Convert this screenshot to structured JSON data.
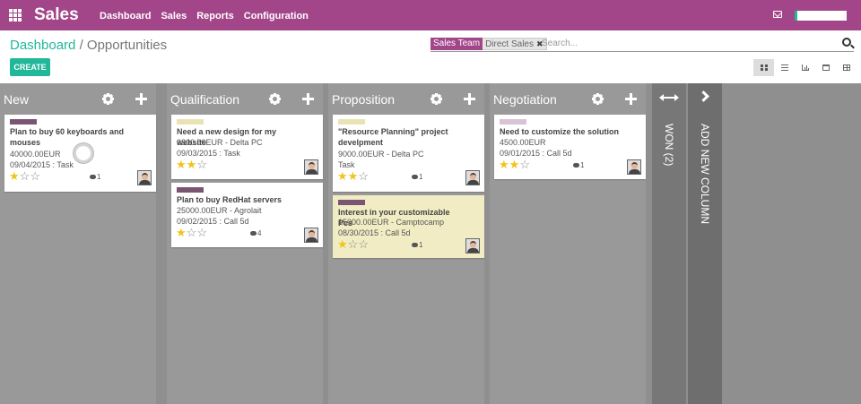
{
  "app": {
    "brand": "Sales",
    "menu": [
      "Dashboard",
      "Sales",
      "Reports",
      "Configuration"
    ]
  },
  "breadcrumb": {
    "parent": "Dashboard",
    "separator": "/",
    "current": "Opportunities"
  },
  "search": {
    "facet_label": "Sales Team",
    "facet_value": "Direct Sales",
    "facet_remove": "✖",
    "placeholder": "Search..."
  },
  "toolbar": {
    "create_label": "CREATE"
  },
  "views": [
    "kanban-view-icon",
    "list-view-icon",
    "graph-view-icon",
    "calendar-view-icon",
    "pivot-view-icon"
  ],
  "colors": {
    "brand": "#a24689",
    "accent": "#21b799",
    "star": "#f0c419"
  },
  "columns": [
    {
      "title": "New",
      "cards": [
        {
          "title": "Plan to buy 60 keyboards and mouses",
          "line1": "40000.00EUR",
          "line2": "09/04/2015 : Task",
          "stars": 1,
          "messages": "1",
          "tag_color": "#7a5573",
          "highlight": false
        }
      ]
    },
    {
      "title": "Qualification",
      "cards": [
        {
          "title": "Need a new design for my website",
          "line1": "3800.00EUR - Delta PC",
          "line2": "09/03/2015 : Task",
          "stars": 2,
          "messages": "",
          "tag_color": "#e9e3b4",
          "highlight": false
        },
        {
          "title": "Plan to buy RedHat servers",
          "line1": "25000.00EUR - Agrolait",
          "line2": "09/02/2015 : Call 5d",
          "stars": 1,
          "messages": "4",
          "tag_color": "#7a5573",
          "highlight": false
        }
      ]
    },
    {
      "title": "Proposition",
      "cards": [
        {
          "title": "\"Resource Planning\" project develpment",
          "line1": "9000.00EUR - Delta PC",
          "line2": "Task",
          "stars": 2,
          "messages": "1",
          "tag_color": "#e9e3b4",
          "highlight": false
        },
        {
          "title": "Interest in your customizable Pcs",
          "line1": "15000.00EUR - Camptocamp",
          "line2": "08/30/2015 : Call 5d",
          "stars": 1,
          "messages": "1",
          "tag_color": "#7a5573",
          "highlight": true
        }
      ]
    },
    {
      "title": "Negotiation",
      "cards": [
        {
          "title": "Need to customize the solution",
          "line1": "4500.00EUR",
          "line2": "09/01/2015 : Call 5d",
          "stars": 2,
          "messages": "1",
          "tag_color": "#d9c3d6",
          "highlight": false
        }
      ]
    }
  ],
  "folded_column": {
    "label": "WON (2)"
  },
  "add_column": {
    "label": "ADD NEW COLUMN"
  }
}
